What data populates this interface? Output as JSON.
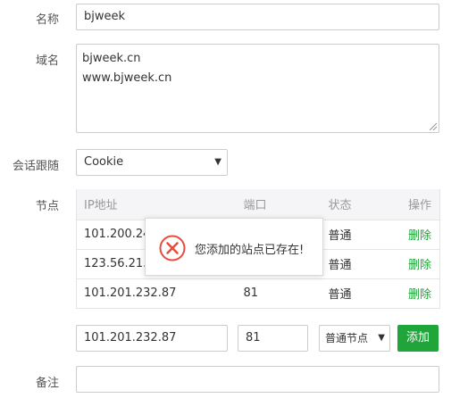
{
  "form": {
    "name_label": "名称",
    "name_value": "bjweek",
    "domain_label": "域名",
    "domain_lines": [
      "bjweek.cn",
      "www.bjweek.cn"
    ],
    "session_label": "会话跟随",
    "session_value": "Cookie",
    "nodes_label": "节点",
    "remark_label": "备注",
    "remark_value": ""
  },
  "table": {
    "headers": {
      "ip": "IP地址",
      "port": "端口",
      "status": "状态",
      "action": "操作"
    },
    "rows": [
      {
        "ip": "101.200.241",
        "port": "",
        "status": "普通",
        "action": "删除"
      },
      {
        "ip": "123.56.21.14",
        "port": "",
        "status": "普通",
        "action": "删除"
      },
      {
        "ip": "101.201.232.87",
        "port": "81",
        "status": "普通",
        "action": "删除"
      }
    ]
  },
  "add_row": {
    "ip_value": "101.201.232.87",
    "port_value": "81",
    "type_value": "普通节点",
    "add_label": "添加"
  },
  "toast": {
    "message": "您添加的站点已存在!",
    "icon": "error-circle-icon",
    "icon_color": "#e74c3c"
  },
  "colors": {
    "accent": "#20a53a",
    "border": "#cccccc"
  }
}
